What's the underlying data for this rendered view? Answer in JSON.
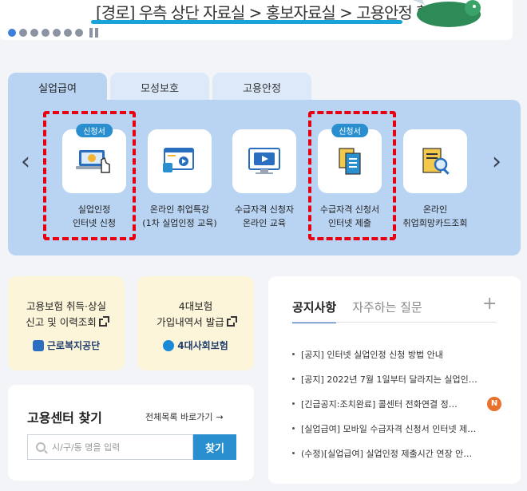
{
  "banner": {
    "text": "[경로] 우측 상단 자료실 > 홍보자료실 > 고용안정 확인"
  },
  "tabs": [
    {
      "label": "실업급여"
    },
    {
      "label": "모성보호"
    },
    {
      "label": "고용안정"
    }
  ],
  "services": [
    {
      "label_line1": "실업인정",
      "label_line2": "인터넷 신청",
      "badge": "신청서",
      "icon": "laptop-payment-icon"
    },
    {
      "label_line1": "온라인 취업특강",
      "label_line2": "(1차 실업인정 교육)",
      "icon": "video-lecture-icon"
    },
    {
      "label_line1": "수급자격 신청자",
      "label_line2": "온라인 교육",
      "icon": "monitor-play-icon"
    },
    {
      "label_line1": "수급자격 신청서",
      "label_line2": "인터넷 제출",
      "badge": "신청서",
      "icon": "documents-icon"
    },
    {
      "label_line1": "온라인",
      "label_line2": "취업희망카드조회",
      "icon": "card-search-icon"
    }
  ],
  "quick_links": [
    {
      "line1": "고용보험 취득·상실",
      "line2": "신고 및 이력조회",
      "org": "근로복지공단"
    },
    {
      "line1": "4대보험",
      "line2": "가입내역서 발급",
      "org": "4대사회보험"
    }
  ],
  "center": {
    "title": "고용센터 찾기",
    "link": "전체목록 바로가기",
    "placeholder": "시/구/동 명을 입력",
    "button": "찾기"
  },
  "notice": {
    "tabs": [
      "공지사항",
      "자주하는 질문"
    ],
    "items": [
      {
        "text": "[공지] 인터넷 실업인정 신청 방법 안내"
      },
      {
        "text": "[공지] 2022년 7월 1일부터 달라지는 실업인…"
      },
      {
        "text": "[긴급공지:조치완료] 콜센터 전화연결 정…",
        "badge": "N"
      },
      {
        "text": "[실업급여] 모바일 수급자격 신청서 인터넷 제…"
      },
      {
        "text": "(수정)[실업급여] 실업인정 제출시간 연장 안…"
      }
    ]
  },
  "colors": {
    "accent": "#2a8fcf",
    "highlight": "#e60012",
    "panel": "#b9d4f3"
  }
}
